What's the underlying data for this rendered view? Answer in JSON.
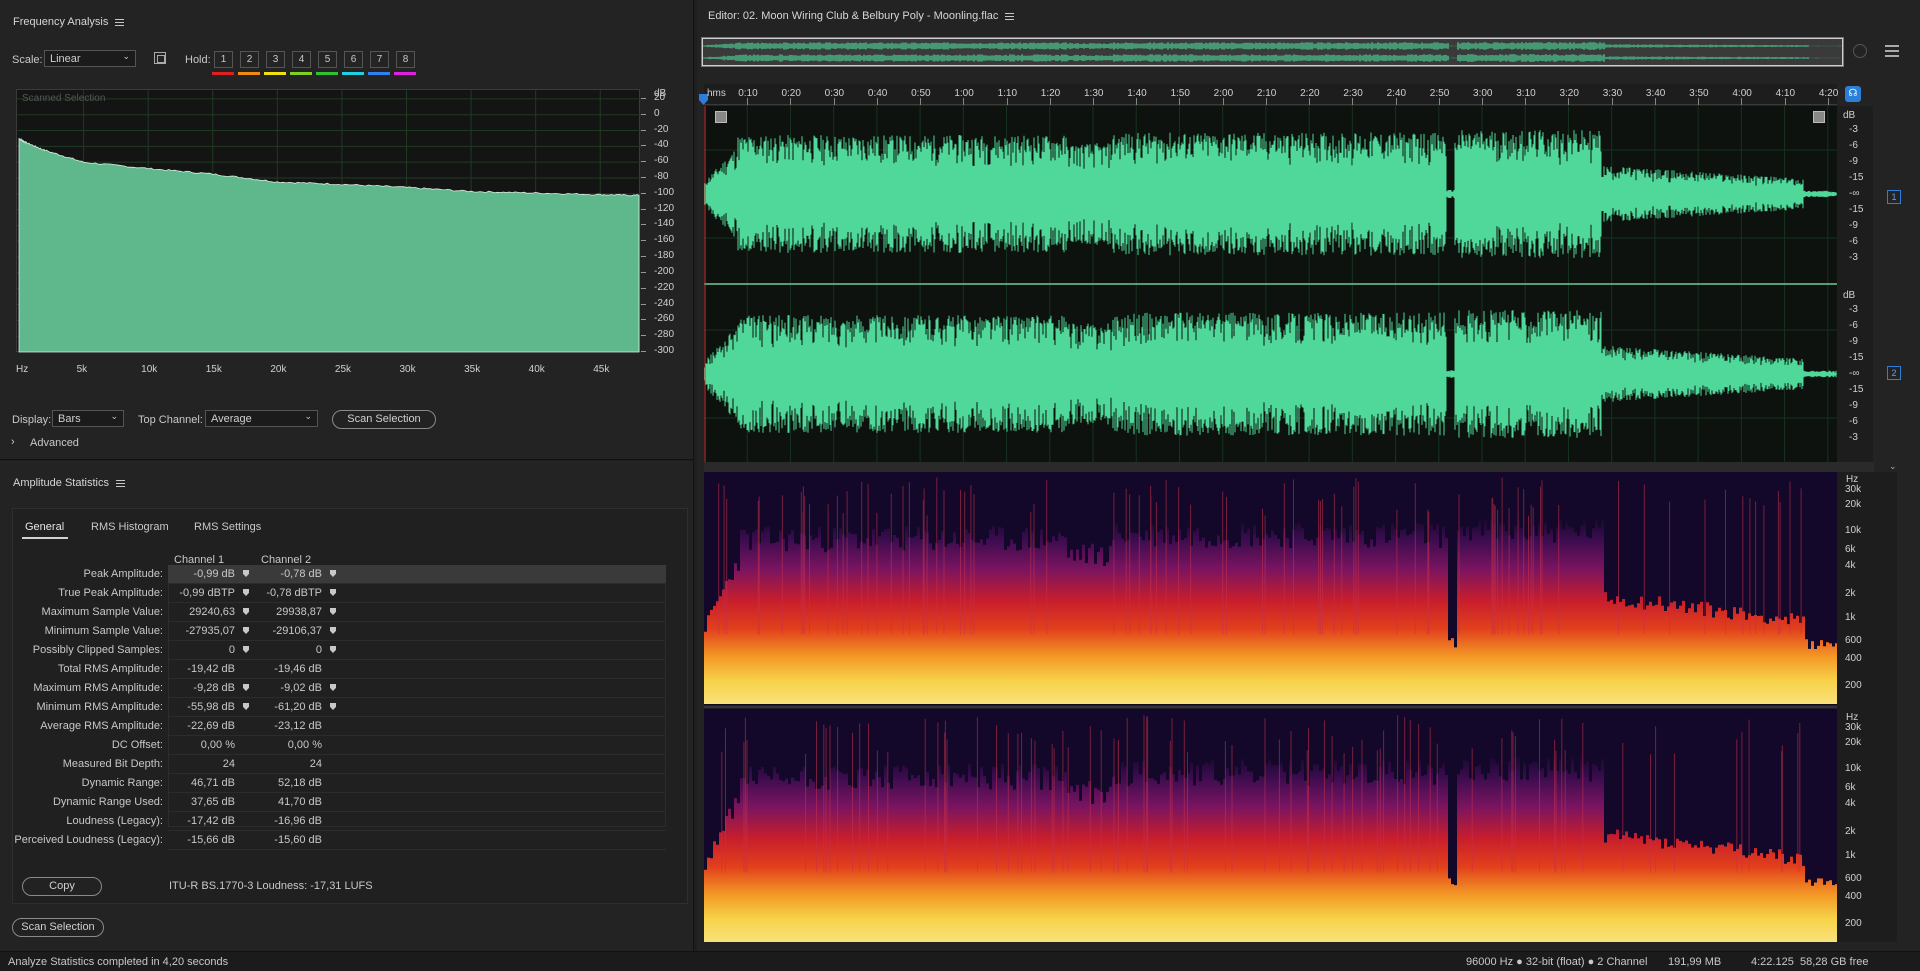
{
  "freq_panel": {
    "title": "Frequency Analysis",
    "scale_label": "Scale:",
    "scale_value": "Linear",
    "hold_label": "Hold:",
    "hold_buttons": [
      "1",
      "2",
      "3",
      "4",
      "5",
      "6",
      "7",
      "8"
    ],
    "hold_colors": [
      "#e02020",
      "#f08a10",
      "#f0e010",
      "#80d020",
      "#30c030",
      "#20d0e0",
      "#3080f0",
      "#e020e0"
    ],
    "overlay_label": "Scanned Selection",
    "display_label": "Display:",
    "display_value": "Bars",
    "top_channel_label": "Top Channel:",
    "top_channel_value": "Average",
    "scan_button": "Scan Selection",
    "advanced_label": "Advanced"
  },
  "stats_panel": {
    "title": "Amplitude Statistics",
    "tabs": [
      "General",
      "RMS Histogram",
      "RMS Settings"
    ],
    "columns": [
      "Channel 1",
      "Channel 2"
    ],
    "rows": [
      {
        "label": "Peak Amplitude:",
        "c1": "-0,99 dB",
        "c2": "-0,78 dB",
        "mark": true
      },
      {
        "label": "True Peak Amplitude:",
        "c1": "-0,99 dBTP",
        "c2": "-0,78 dBTP",
        "mark": true
      },
      {
        "label": "Maximum Sample Value:",
        "c1": "29240,63",
        "c2": "29938,87",
        "mark": true
      },
      {
        "label": "Minimum Sample Value:",
        "c1": "-27935,07",
        "c2": "-29106,37",
        "mark": true
      },
      {
        "label": "Possibly Clipped Samples:",
        "c1": "0",
        "c2": "0",
        "mark": true
      },
      {
        "label": "Total RMS Amplitude:",
        "c1": "-19,42 dB",
        "c2": "-19,46 dB",
        "mark": false
      },
      {
        "label": "Maximum RMS Amplitude:",
        "c1": "-9,28 dB",
        "c2": "-9,02 dB",
        "mark": true
      },
      {
        "label": "Minimum RMS Amplitude:",
        "c1": "-55,98 dB",
        "c2": "-61,20 dB",
        "mark": true
      },
      {
        "label": "Average RMS Amplitude:",
        "c1": "-22,69 dB",
        "c2": "-23,12 dB",
        "mark": false
      },
      {
        "label": "DC Offset:",
        "c1": "0,00 %",
        "c2": "0,00 %",
        "mark": false
      },
      {
        "label": "Measured Bit Depth:",
        "c1": "24",
        "c2": "24",
        "mark": false
      },
      {
        "label": "Dynamic Range:",
        "c1": "46,71 dB",
        "c2": "52,18 dB",
        "mark": false
      },
      {
        "label": "Dynamic Range Used:",
        "c1": "37,65 dB",
        "c2": "41,70 dB",
        "mark": false
      },
      {
        "label": "Loudness (Legacy):",
        "c1": "-17,42 dB",
        "c2": "-16,96 dB",
        "mark": false
      },
      {
        "label": "Perceived Loudness (Legacy):",
        "c1": "-15,66 dB",
        "c2": "-15,60 dB",
        "mark": false
      }
    ],
    "copy_button": "Copy",
    "loudness_text": "ITU-R BS.1770-3 Loudness: -17,31 LUFS",
    "scan_button": "Scan Selection"
  },
  "editor": {
    "title": "Editor: 02. Moon Wiring Club & Belbury Poly - Moonling.flac",
    "time_unit": "hms",
    "time_ticks": [
      "0:10",
      "0:20",
      "0:30",
      "0:40",
      "0:50",
      "1:00",
      "1:10",
      "1:20",
      "1:30",
      "1:40",
      "1:50",
      "2:00",
      "2:10",
      "2:20",
      "2:30",
      "2:40",
      "2:50",
      "3:00",
      "3:10",
      "3:20",
      "3:30",
      "3:40",
      "3:50",
      "4:00",
      "4:10",
      "4:20"
    ],
    "db_unit": "dB",
    "db_scale": [
      "-3",
      "-6",
      "-9",
      "-15",
      "-∞",
      "-15",
      "-9",
      "-6",
      "-3"
    ],
    "channel_badges": [
      "1",
      "2"
    ],
    "hz_unit": "Hz",
    "hz_scale": [
      "30k",
      "20k",
      "10k",
      "6k",
      "4k",
      "2k",
      "1k",
      "600",
      "400",
      "200"
    ]
  },
  "spectrum_chart": {
    "db_labels": [
      "dB",
      "20",
      "0",
      "-20",
      "-40",
      "-60",
      "-80",
      "-100",
      "-120",
      "-140",
      "-160",
      "-180",
      "-200",
      "-220",
      "-240",
      "-260",
      "-280",
      "-300"
    ],
    "hz_labels": [
      "Hz",
      "5k",
      "10k",
      "15k",
      "20k",
      "25k",
      "30k",
      "35k",
      "40k",
      "45k"
    ]
  },
  "chart_data": {
    "type": "area",
    "x": [
      0,
      500,
      2000,
      5000,
      10000,
      15000,
      20000,
      25000,
      30000,
      35000,
      40000,
      45000,
      48000
    ],
    "series": [
      {
        "values": [
          -30,
          -35,
          -45,
          -60,
          -68,
          -75,
          -85,
          -88,
          -92,
          -97,
          -99,
          -101,
          -102
        ]
      }
    ],
    "xlim": [
      0,
      48000
    ],
    "ylim": [
      -300,
      30
    ]
  },
  "status_bar": {
    "message": "Analyze Statistics completed in 4,20 seconds",
    "sample_format": "96000 Hz ● 32-bit (float) ● 2 Channel",
    "size": "191,99 MB",
    "duration": "4:22.125",
    "free": "58,28 GB free"
  },
  "colors": {
    "waveform": "#4fd89a",
    "background": "#1e1e1e",
    "accent": "#2b7fd8"
  }
}
